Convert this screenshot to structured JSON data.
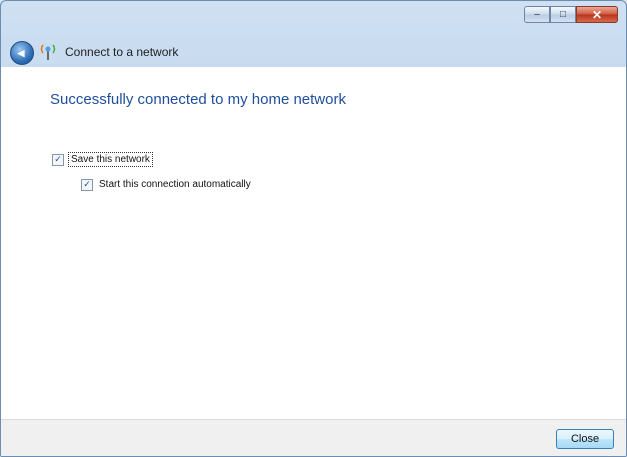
{
  "window": {
    "title": "Connect to a network",
    "caption_buttons": {
      "minimize": "–",
      "maximize": "□",
      "close": "✕"
    }
  },
  "back_button": {
    "glyph": "◀"
  },
  "main": {
    "heading": "Successfully connected to my home network",
    "options": [
      {
        "label": "Save this network",
        "checked": true,
        "check_glyph": "✓"
      },
      {
        "label": "Start this connection automatically",
        "checked": true,
        "check_glyph": "✓"
      }
    ]
  },
  "footer": {
    "close_label": "Close"
  },
  "colors": {
    "heading": "#1f4f9c",
    "titlebar": "#bcd3ec",
    "close_caption": "#d0573f"
  }
}
